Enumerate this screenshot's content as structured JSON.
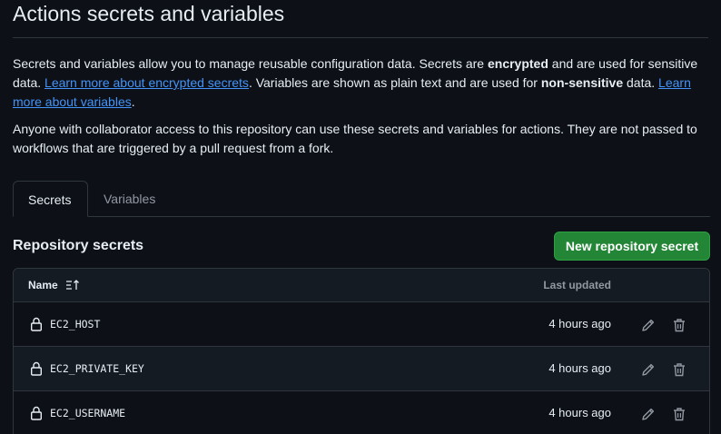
{
  "page": {
    "title": "Actions secrets and variables"
  },
  "description": {
    "p1_part1": "Secrets and variables allow you to manage reusable configuration data. Secrets are ",
    "p1_bold1": "encrypted",
    "p1_part2": " and are used for sensitive data. ",
    "p1_link1": "Learn more about encrypted secrets",
    "p1_part3": ". Variables are shown as plain text and are used for ",
    "p1_bold2": "non-sensitive",
    "p1_part4": " data. ",
    "p1_link2": "Learn more about variables",
    "p1_part5": ".",
    "p2": "Anyone with collaborator access to this repository can use these secrets and variables for actions. They are not passed to workflows that are triggered by a pull request from a fork."
  },
  "tabs": {
    "secrets": "Secrets",
    "variables": "Variables",
    "active": "Secrets"
  },
  "section": {
    "title": "Repository secrets",
    "new_button": "New repository secret"
  },
  "table": {
    "col_name": "Name",
    "col_updated": "Last updated",
    "rows": [
      {
        "name": "EC2_HOST",
        "updated": "4 hours ago"
      },
      {
        "name": "EC2_PRIVATE_KEY",
        "updated": "4 hours ago"
      },
      {
        "name": "EC2_USERNAME",
        "updated": "4 hours ago"
      }
    ]
  },
  "colors": {
    "background": "#0d1117",
    "link": "#4493f8",
    "primary_button": "#238636",
    "border": "#30363d",
    "muted_text": "#9198a1"
  },
  "icons": {
    "sort": "sort-ascending-icon",
    "lock": "lock-icon",
    "edit": "pencil-icon",
    "delete": "trash-icon"
  }
}
